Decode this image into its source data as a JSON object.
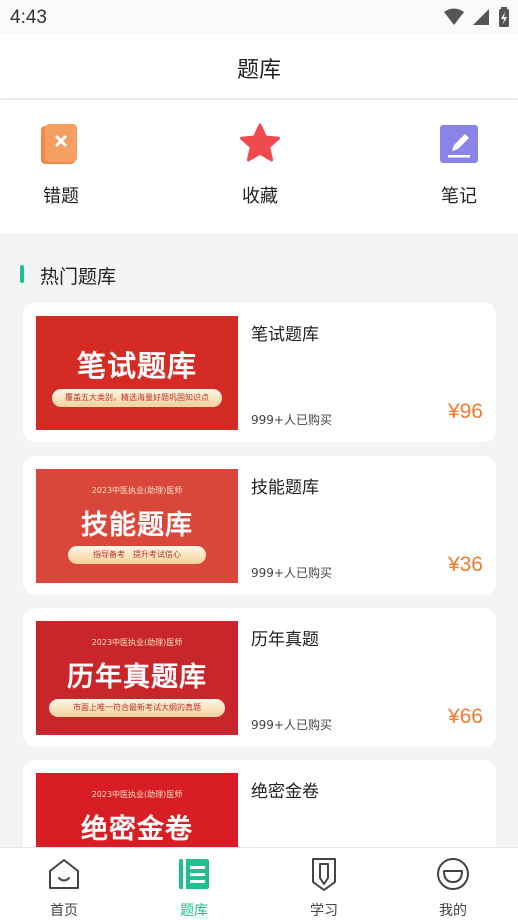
{
  "status_bar": {
    "time": "4:43"
  },
  "header": {
    "title": "题库"
  },
  "quick_actions": [
    {
      "label": "错题",
      "icon": "error-book-icon"
    },
    {
      "label": "收藏",
      "icon": "star-icon"
    },
    {
      "label": "笔记",
      "icon": "note-edit-icon"
    }
  ],
  "section": {
    "title": "热门题库"
  },
  "cards": [
    {
      "title": "笔试题库",
      "count": "999+人已购买",
      "price": "¥96",
      "banner": {
        "small": "",
        "big": "笔试题库",
        "pill": "覆盖五大类别，精选海量好题巩固知识点"
      }
    },
    {
      "title": "技能题库",
      "count": "999+人已购买",
      "price": "¥36",
      "banner": {
        "small": "2023中医执业(助理)医师",
        "big": "技能题库",
        "pill": "指导备考　提升考试信心"
      }
    },
    {
      "title": "历年真题",
      "count": "999+人已购买",
      "price": "¥66",
      "banner": {
        "small": "2023中医执业(助理)医师",
        "big": "历年真题库",
        "pill": "市面上唯一符合最新考试大纲的真题"
      }
    },
    {
      "title": "绝密金卷",
      "count": "",
      "price": "",
      "banner": {
        "small": "2023中医执业(助理)医师",
        "big": "绝密金卷",
        "pill": ""
      }
    }
  ],
  "tabbar": [
    {
      "label": "首页",
      "icon": "home-icon",
      "active": false
    },
    {
      "label": "题库",
      "icon": "question-bank-icon",
      "active": true
    },
    {
      "label": "学习",
      "icon": "study-pencil-icon",
      "active": false
    },
    {
      "label": "我的",
      "icon": "profile-icon",
      "active": false
    }
  ],
  "colors": {
    "accent": "#1fbf8f",
    "price": "#f07b2f",
    "banner_red": "#d42b25"
  }
}
